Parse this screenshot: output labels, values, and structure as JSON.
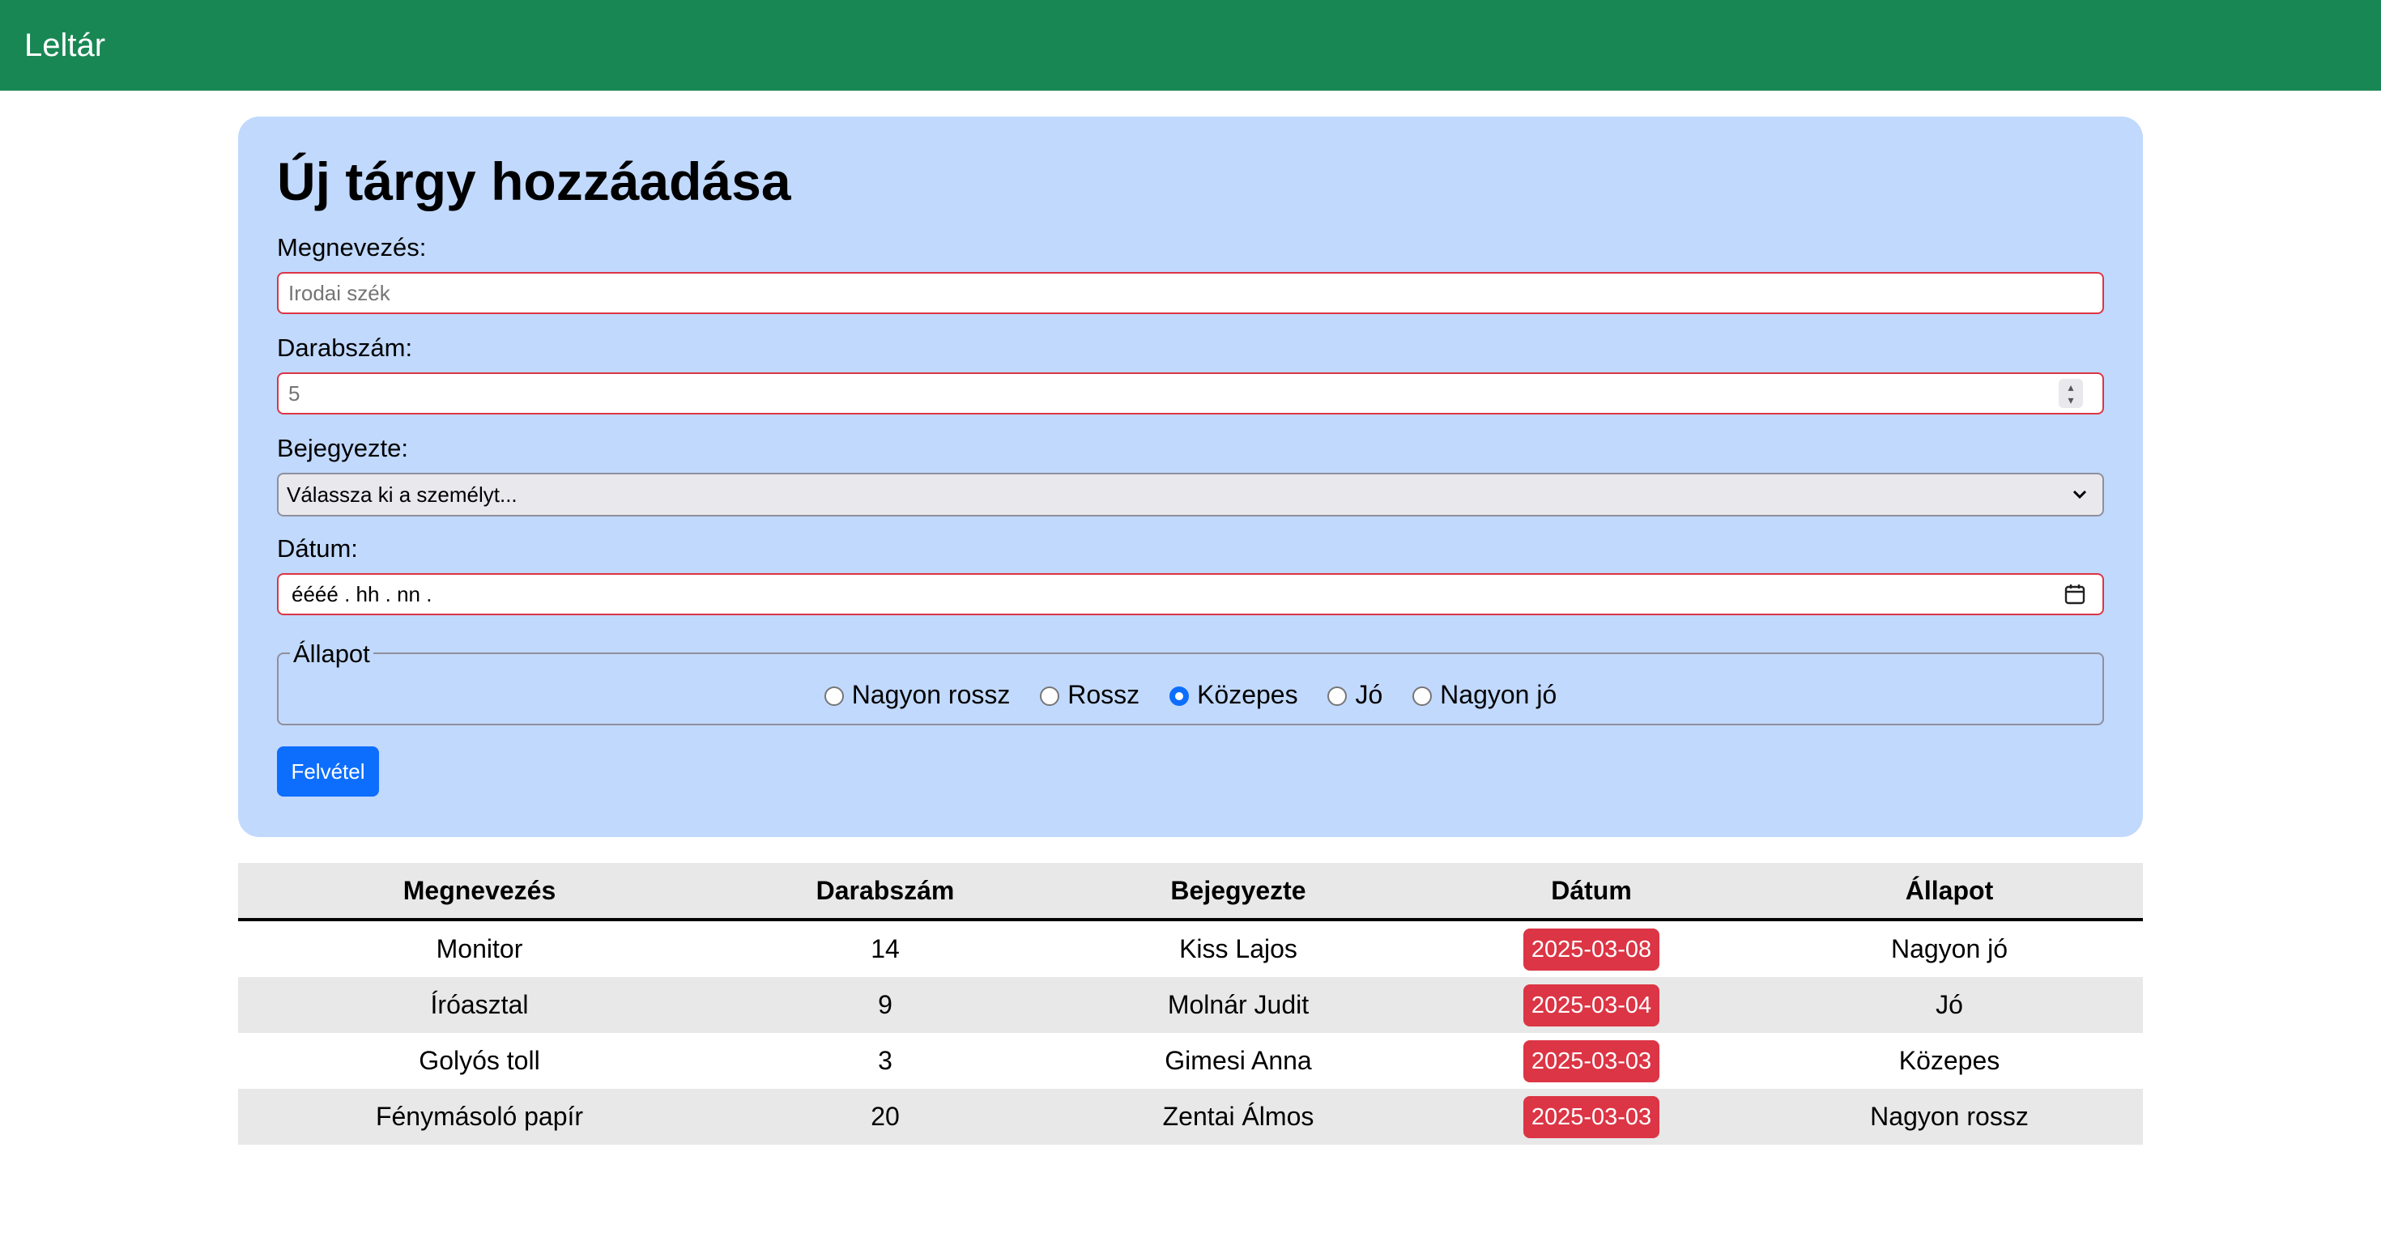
{
  "header": {
    "brand": "Leltár",
    "color": "#198754"
  },
  "form": {
    "title": "Új tárgy hozzáadása",
    "name_label": "Megnevezés:",
    "name_placeholder": "Irodai szék",
    "count_label": "Darabszám:",
    "count_placeholder": "5",
    "person_label": "Bejegyezte:",
    "person_selected": "Válassza ki a személyt...",
    "date_label": "Dátum:",
    "date_value": "éééé .  hh .  nn .",
    "condition_legend": "Állapot",
    "condition_options": [
      "Nagyon rossz",
      "Rossz",
      "Közepes",
      "Jó",
      "Nagyon jó"
    ],
    "condition_selected": "Közepes",
    "submit_label": "Felvétel"
  },
  "table": {
    "headers": [
      "Megnevezés",
      "Darabszám",
      "Bejegyezte",
      "Dátum",
      "Állapot"
    ],
    "rows": [
      {
        "name": "Monitor",
        "count": "14",
        "person": "Kiss Lajos",
        "date": "2025-03-08",
        "condition": "Nagyon jó"
      },
      {
        "name": "Íróasztal",
        "count": "9",
        "person": "Molnár Judit",
        "date": "2025-03-04",
        "condition": "Jó"
      },
      {
        "name": "Golyós toll",
        "count": "3",
        "person": "Gimesi Anna",
        "date": "2025-03-03",
        "condition": "Közepes"
      },
      {
        "name": "Fénymásoló papír",
        "count": "20",
        "person": "Zentai Álmos",
        "date": "2025-03-03",
        "condition": "Nagyon rossz"
      }
    ]
  },
  "icons": {
    "select_arrow": "chevron-down-icon",
    "date_picker": "calendar-icon",
    "spinner": "spinner-arrows-icon"
  }
}
